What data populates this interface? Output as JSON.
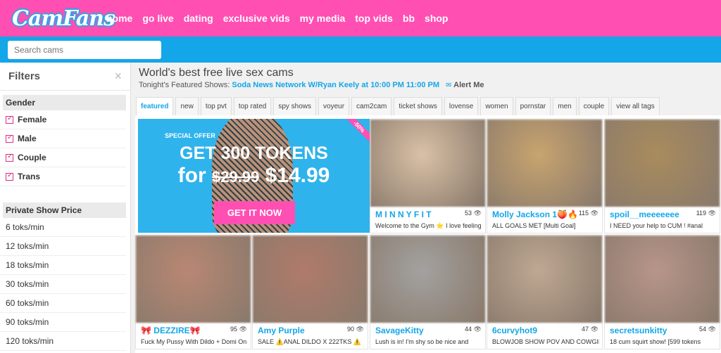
{
  "brand": {
    "logo_text": "CamFans"
  },
  "nav": [
    "home",
    "go live",
    "dating",
    "exclusive vids",
    "my media",
    "top vids",
    "bb",
    "shop"
  ],
  "search": {
    "placeholder": "Search cams",
    "value": ""
  },
  "sidebar": {
    "title": "Filters",
    "close": "×",
    "gender": {
      "title": "Gender",
      "items": [
        "Female",
        "Male",
        "Couple",
        "Trans"
      ]
    },
    "price": {
      "title": "Private Show Price",
      "items": [
        "6 toks/min",
        "12 toks/min",
        "18 toks/min",
        "30 toks/min",
        "60 toks/min",
        "90 toks/min",
        "120 toks/min"
      ]
    }
  },
  "main": {
    "title": "World's best free live sex cams",
    "featured_prefix": "Tonight's Featured Shows:",
    "featured_show": "Soda News Network W/Ryan Keely at 10:00 PM 11:00 PM",
    "alert": "Alert Me"
  },
  "tabs": [
    "featured",
    "new",
    "top pvt",
    "top rated",
    "spy shows",
    "voyeur",
    "cam2cam",
    "ticket shows",
    "lovense",
    "women",
    "pornstar",
    "men",
    "couple",
    "view all tags"
  ],
  "promo": {
    "special": "SPECIAL OFFER",
    "headline": "GET 300 TOKENS",
    "for": "for",
    "old_price": "$29.99",
    "new_price": "$14.99",
    "button": "GET IT NOW",
    "badge": "-50%"
  },
  "cards": [
    {
      "name": "M I N N Y F I T",
      "count": "53",
      "subtitle": "Welcome to the Gym ⭐ I love feeling",
      "thumb_color": "#d9c1a6"
    },
    {
      "name": "Molly Jackson 1🍑🔥",
      "count": "115",
      "subtitle": "ALL GOALS MET [Multi Goal]",
      "thumb_color": "#c8a46f"
    },
    {
      "name": "spoil__meeeeeee",
      "count": "119",
      "subtitle": "I NEED your help to  CUM ! #anal",
      "thumb_color": "#a98c5d"
    },
    {
      "name": "🎀 DEZZIRE🎀",
      "count": "95",
      "subtitle": "Fuck My Pussy With Dildo + Domi On",
      "thumb_color": "#b98773"
    },
    {
      "name": "Amy Purple",
      "count": "90",
      "subtitle": "SALE ⚠️ANAL DILDO  X 222TKS ⚠️",
      "thumb_color": "#b07a6a"
    },
    {
      "name": "SavageKitty",
      "count": "44",
      "subtitle": "Lush is in!  I'm shy so be nice and",
      "thumb_color": "#a3a2a0"
    },
    {
      "name": "6curvyhot9",
      "count": "47",
      "subtitle": "BLOWJOB SHOW POV AND COWGIRL",
      "thumb_color": "#bfa893"
    },
    {
      "name": "secretsunkitty",
      "count": "54",
      "subtitle": "18 cum squirt show! [599 tokens",
      "thumb_color": "#b8958a"
    }
  ]
}
